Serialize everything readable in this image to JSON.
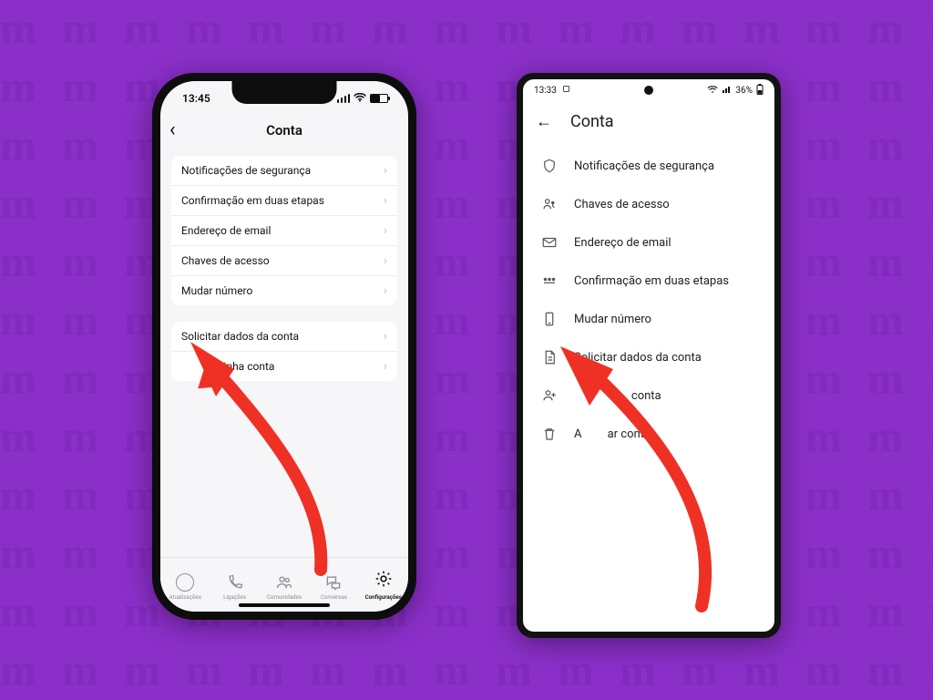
{
  "background_color": "#8b2fc9",
  "arrow_color": "#ee3124",
  "ios": {
    "status_time": "13:45",
    "title": "Conta",
    "group1": [
      "Notificações de segurança",
      "Confirmação em duas etapas",
      "Endereço de email",
      "Chaves de acesso",
      "Mudar número"
    ],
    "group2_row1": "Solicitar dados da conta",
    "group2_row2_suffix": "inha conta",
    "tabs": [
      "Atualizações",
      "Ligações",
      "Comunidades",
      "Conversas",
      "Configurações"
    ]
  },
  "android": {
    "status_time": "13:33",
    "status_batt": "36%",
    "title": "Conta",
    "rows": [
      "Notificações de segurança",
      "Chaves de acesso",
      "Endereço de email",
      "Confirmação em duas etapas",
      "Mudar número",
      "Solicitar dados da conta"
    ],
    "row7_suffix": "conta",
    "row8_prefix": "A",
    "row8_suffix": "ar conta"
  }
}
